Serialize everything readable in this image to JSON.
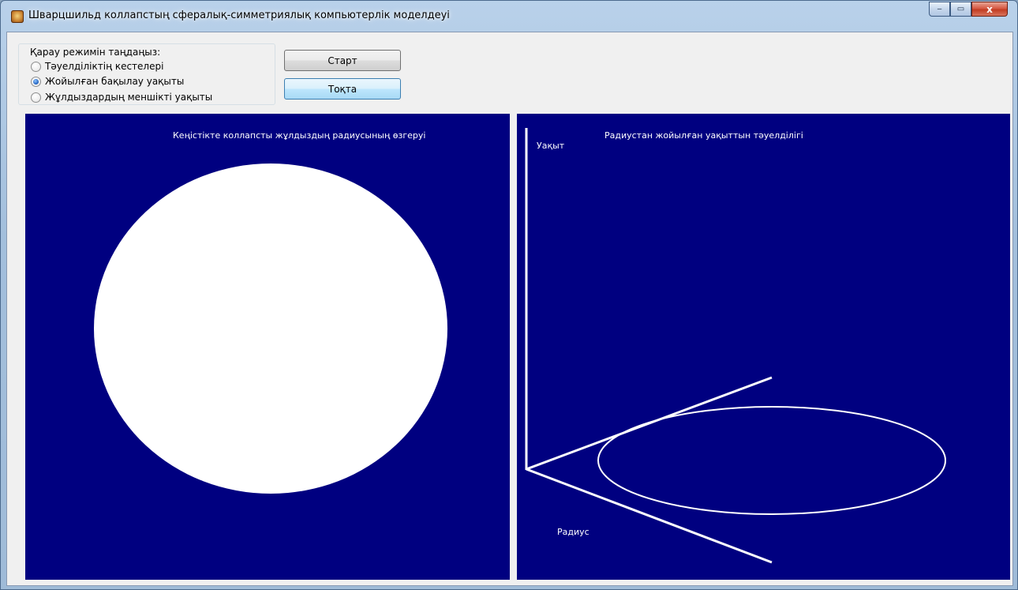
{
  "window": {
    "title": "Шварцшильд коллапстың сфералық-симметриялық компьютерлік моделдеуі",
    "minimize_glyph": "‒",
    "maximize_glyph": "▭",
    "close_glyph": "x"
  },
  "mode_group": {
    "label": "Қарау режимін таңдаңыз:",
    "options": [
      {
        "label": "Тәуелділіктің кестелері",
        "selected": false
      },
      {
        "label": "Жойылған бақылау уақыты",
        "selected": true
      },
      {
        "label": "Жұлдыздардың меншікті уақыты",
        "selected": false
      }
    ]
  },
  "buttons": {
    "start": "Старт",
    "stop": "Тоқта"
  },
  "left_panel": {
    "title": "Кеңістікте коллапсты жұлдыздың радиусының өзгеруі"
  },
  "right_panel": {
    "title": "Радиустан жойылған уақыттын тәуелділігі",
    "y_axis_label": "Уақыт",
    "x_axis_label": "Радиус"
  },
  "colors": {
    "panel_background": "#000080",
    "drawing": "#ffffff"
  }
}
